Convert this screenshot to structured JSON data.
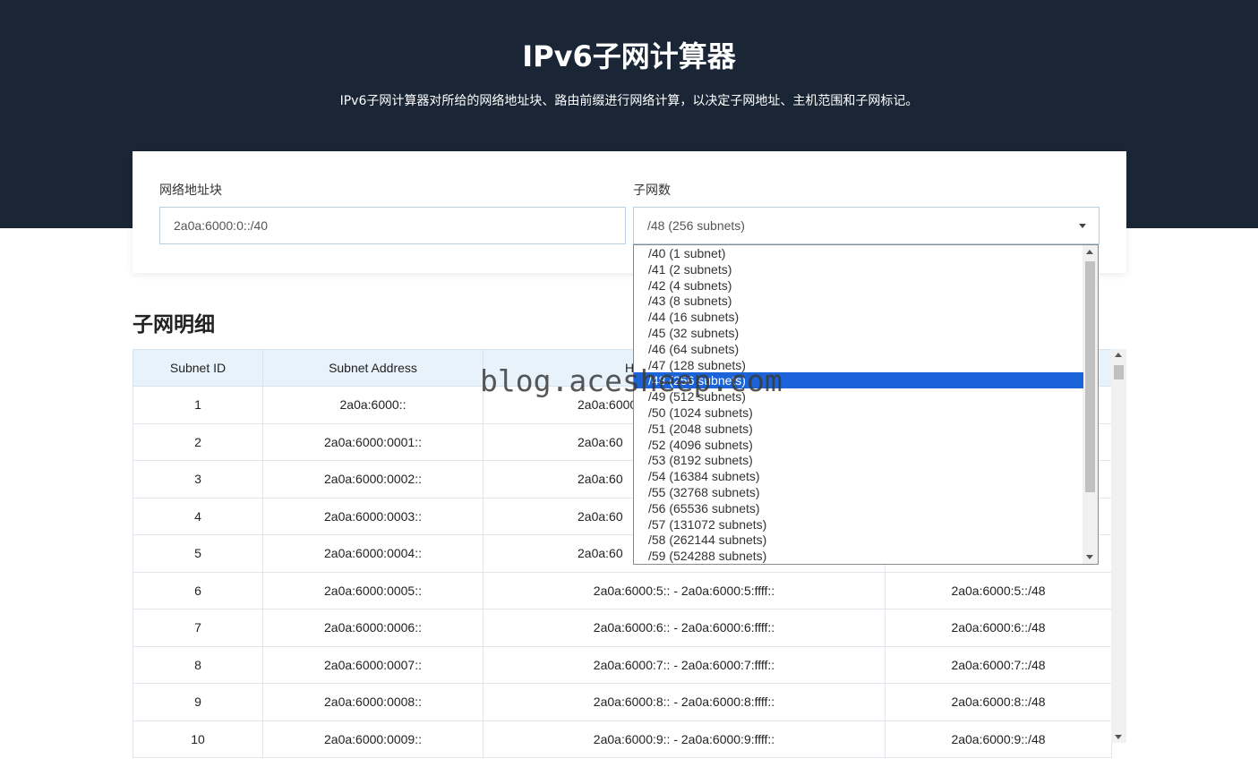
{
  "header": {
    "title": "IPv6子网计算器",
    "subtitle": "IPv6子网计算器对所给的网络地址块、路由前缀进行网络计算，以决定子网地址、主机范围和子网标记。"
  },
  "form": {
    "network_label": "网络地址块",
    "network_value": "2a0a:6000:0::/40",
    "subnet_count_label": "子网数",
    "subnet_count_value": "/48 (256 subnets)"
  },
  "dropdown": {
    "options": [
      "/40 (1 subnet)",
      "/41 (2 subnets)",
      "/42 (4 subnets)",
      "/43 (8 subnets)",
      "/44 (16 subnets)",
      "/45 (32 subnets)",
      "/46 (64 subnets)",
      "/47 (128 subnets)",
      "/48 (256 subnets)",
      "/49 (512 subnets)",
      "/50 (1024 subnets)",
      "/51 (2048 subnets)",
      "/52 (4096 subnets)",
      "/53 (8192 subnets)",
      "/54 (16384 subnets)",
      "/55 (32768 subnets)",
      "/56 (65536 subnets)",
      "/57 (131072 subnets)",
      "/58 (262144 subnets)",
      "/59 (524288 subnets)"
    ],
    "selected_index": 8
  },
  "details": {
    "title": "子网明细",
    "columns": [
      "Subnet ID",
      "Subnet Address",
      "H",
      ""
    ],
    "rows": [
      [
        "1",
        "2a0a:6000::",
        "2a0a:6000",
        ""
      ],
      [
        "2",
        "2a0a:6000:0001::",
        "2a0a:60",
        ""
      ],
      [
        "3",
        "2a0a:6000:0002::",
        "2a0a:60",
        ""
      ],
      [
        "4",
        "2a0a:6000:0003::",
        "2a0a:60",
        ""
      ],
      [
        "5",
        "2a0a:6000:0004::",
        "2a0a:60",
        ""
      ],
      [
        "6",
        "2a0a:6000:0005::",
        "2a0a:6000:5:: - 2a0a:6000:5:ffff::",
        "2a0a:6000:5::/48"
      ],
      [
        "7",
        "2a0a:6000:0006::",
        "2a0a:6000:6:: - 2a0a:6000:6:ffff::",
        "2a0a:6000:6::/48"
      ],
      [
        "8",
        "2a0a:6000:0007::",
        "2a0a:6000:7:: - 2a0a:6000:7:ffff::",
        "2a0a:6000:7::/48"
      ],
      [
        "9",
        "2a0a:6000:0008::",
        "2a0a:6000:8:: - 2a0a:6000:8:ffff::",
        "2a0a:6000:8::/48"
      ],
      [
        "10",
        "2a0a:6000:0009::",
        "2a0a:6000:9:: - 2a0a:6000:9:ffff::",
        "2a0a:6000:9::/48"
      ]
    ]
  },
  "watermark": "blog.acesheep.com",
  "colors": {
    "hero_bg": "#1a2636",
    "header_row_bg": "#e8f2fb",
    "selected_option_bg": "#1a63d8"
  }
}
